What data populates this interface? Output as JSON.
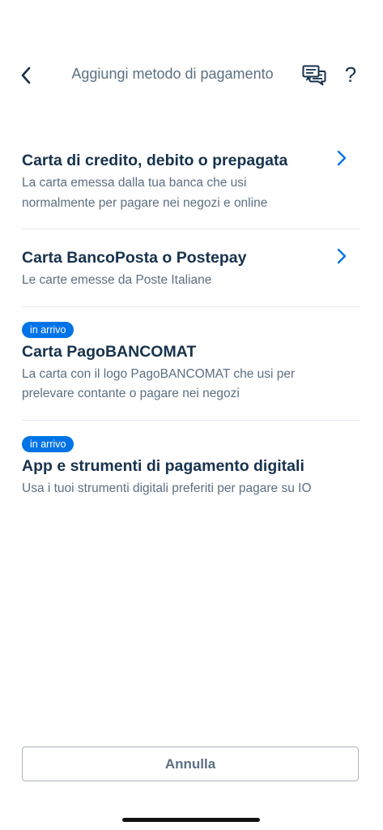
{
  "header": {
    "title": "Aggiungi metodo di pagamento",
    "back_icon": "chevron-left-icon",
    "chat_icon": "chat-bubbles-icon",
    "help_label": "?"
  },
  "methods": [
    {
      "title": "Carta di credito, debito o prepagata",
      "description": "La carta emessa dalla tua banca che usi normalmente per pagare nei negozi e online",
      "badge": "",
      "has_chevron": true
    },
    {
      "title": "Carta BancoPosta o Postepay",
      "description": "Le carte emesse da Poste Italiane",
      "badge": "",
      "has_chevron": true
    },
    {
      "title": "Carta PagoBANCOMAT",
      "description": "La carta con il logo PagoBANCOMAT che usi per prelevare contante o pagare nei negozi",
      "badge": "in arrivo",
      "has_chevron": false
    },
    {
      "title": "App e strumenti di pagamento digitali",
      "description": "Usa i tuoi strumenti digitali preferiti per pagare su IO",
      "badge": "in arrivo",
      "has_chevron": false
    }
  ],
  "footer": {
    "cancel_label": "Annulla"
  },
  "colors": {
    "primary_text": "#17324d",
    "secondary_text": "#5c6f82",
    "accent": "#0073e6",
    "divider": "#e6e9f2"
  }
}
